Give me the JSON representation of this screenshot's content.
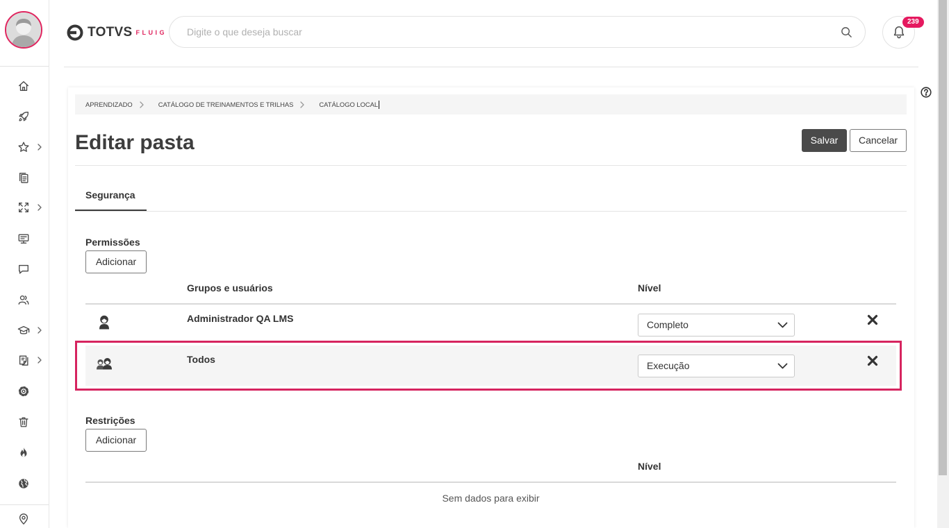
{
  "header": {
    "logo_main": "TOTVS",
    "logo_sub": "FLUIG",
    "search": {
      "placeholder": "Digite o que deseja buscar",
      "value": ""
    },
    "notifications": {
      "count": "239"
    }
  },
  "sidebar": {
    "items": [
      {
        "icon": "home-icon",
        "has_submenu": false
      },
      {
        "icon": "rocket-icon",
        "has_submenu": false
      },
      {
        "icon": "star-icon",
        "has_submenu": true
      },
      {
        "icon": "documents-icon",
        "has_submenu": false
      },
      {
        "icon": "move-arrows-icon",
        "has_submenu": true
      },
      {
        "icon": "presentation-icon",
        "has_submenu": false
      },
      {
        "icon": "chat-icon",
        "has_submenu": false
      },
      {
        "icon": "users-icon",
        "has_submenu": false
      },
      {
        "icon": "graduation-cap-icon",
        "has_submenu": true
      },
      {
        "icon": "book-icon",
        "has_submenu": true
      },
      {
        "icon": "gear-icon",
        "has_submenu": false
      },
      {
        "icon": "trash-icon",
        "has_submenu": false
      },
      {
        "icon": "flame-icon",
        "has_submenu": false
      },
      {
        "icon": "globe-icon",
        "has_submenu": false
      },
      {
        "icon": "map-pin-icon",
        "has_submenu": false
      }
    ]
  },
  "breadcrumb": [
    {
      "label": "APRENDIZADO"
    },
    {
      "label": "CATÁLOGO DE TREINAMENTOS E TRILHAS"
    },
    {
      "label": "CATÁLOGO LOCAL"
    }
  ],
  "page": {
    "title": "Editar pasta",
    "save_label": "Salvar",
    "cancel_label": "Cancelar"
  },
  "tabs": [
    {
      "label": "Segurança",
      "active": true
    }
  ],
  "permissions": {
    "title": "Permissões",
    "add_label": "Adicionar",
    "columns": {
      "name": "Grupos e usuários",
      "level": "Nível"
    },
    "rows": [
      {
        "type_icon": "user-icon",
        "name": "Administrador QA LMS",
        "level": "Completo",
        "highlighted": false
      },
      {
        "type_icon": "group-icon",
        "name": "Todos",
        "level": "Execução",
        "highlighted": true
      }
    ]
  },
  "restrictions": {
    "title": "Restrições",
    "add_label": "Adicionar",
    "columns": {
      "level": "Nível"
    },
    "rows": [],
    "empty_text": "Sem dados para exibir"
  },
  "colors": {
    "accent": "#e0245e",
    "badge": "#e5195f",
    "highlight_border": "#d6245f",
    "primary_button": "#4a4a4a",
    "row_highlight_bg": "#f5f5f5"
  }
}
